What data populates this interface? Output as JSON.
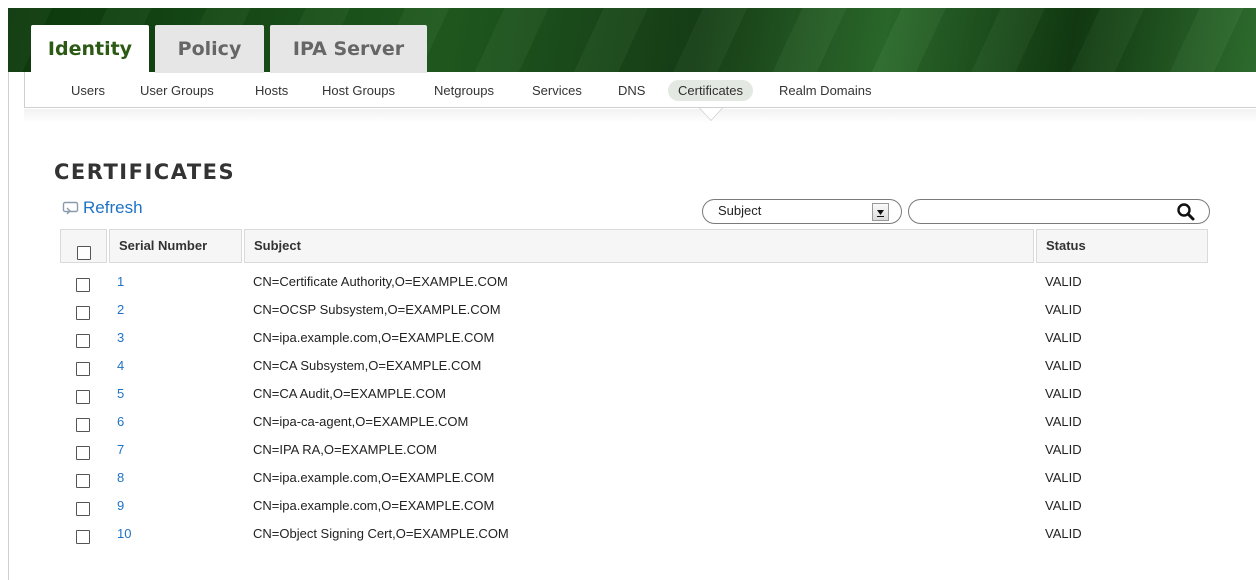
{
  "top_tabs": [
    {
      "label": "Identity",
      "active": true
    },
    {
      "label": "Policy",
      "active": false
    },
    {
      "label": "IPA Server",
      "active": false
    }
  ],
  "subnav": [
    {
      "label": "Users",
      "active": false
    },
    {
      "label": "User Groups",
      "active": false
    },
    {
      "label": "Hosts",
      "active": false
    },
    {
      "label": "Host Groups",
      "active": false
    },
    {
      "label": "Netgroups",
      "active": false
    },
    {
      "label": "Services",
      "active": false
    },
    {
      "label": "DNS",
      "active": false
    },
    {
      "label": "Certificates",
      "active": true
    },
    {
      "label": "Realm Domains",
      "active": false
    }
  ],
  "page": {
    "title": "CERTIFICATES",
    "refresh_label": "Refresh"
  },
  "filter": {
    "selected": "Subject",
    "search_value": ""
  },
  "table": {
    "columns": [
      "Serial Number",
      "Subject",
      "Status"
    ],
    "rows": [
      {
        "serial": "1",
        "subject": "CN=Certificate Authority,O=EXAMPLE.COM",
        "status": "VALID"
      },
      {
        "serial": "2",
        "subject": "CN=OCSP Subsystem,O=EXAMPLE.COM",
        "status": "VALID"
      },
      {
        "serial": "3",
        "subject": "CN=ipa.example.com,O=EXAMPLE.COM",
        "status": "VALID"
      },
      {
        "serial": "4",
        "subject": "CN=CA Subsystem,O=EXAMPLE.COM",
        "status": "VALID"
      },
      {
        "serial": "5",
        "subject": "CN=CA Audit,O=EXAMPLE.COM",
        "status": "VALID"
      },
      {
        "serial": "6",
        "subject": "CN=ipa-ca-agent,O=EXAMPLE.COM",
        "status": "VALID"
      },
      {
        "serial": "7",
        "subject": "CN=IPA RA,O=EXAMPLE.COM",
        "status": "VALID"
      },
      {
        "serial": "8",
        "subject": "CN=ipa.example.com,O=EXAMPLE.COM",
        "status": "VALID"
      },
      {
        "serial": "9",
        "subject": "CN=ipa.example.com,O=EXAMPLE.COM",
        "status": "VALID"
      },
      {
        "serial": "10",
        "subject": "CN=Object Signing Cert,O=EXAMPLE.COM",
        "status": "VALID"
      }
    ]
  },
  "colors": {
    "brand_green": "#1f5a1f",
    "active_tab_text": "#2c5a15",
    "link_blue": "#1f73c4"
  }
}
